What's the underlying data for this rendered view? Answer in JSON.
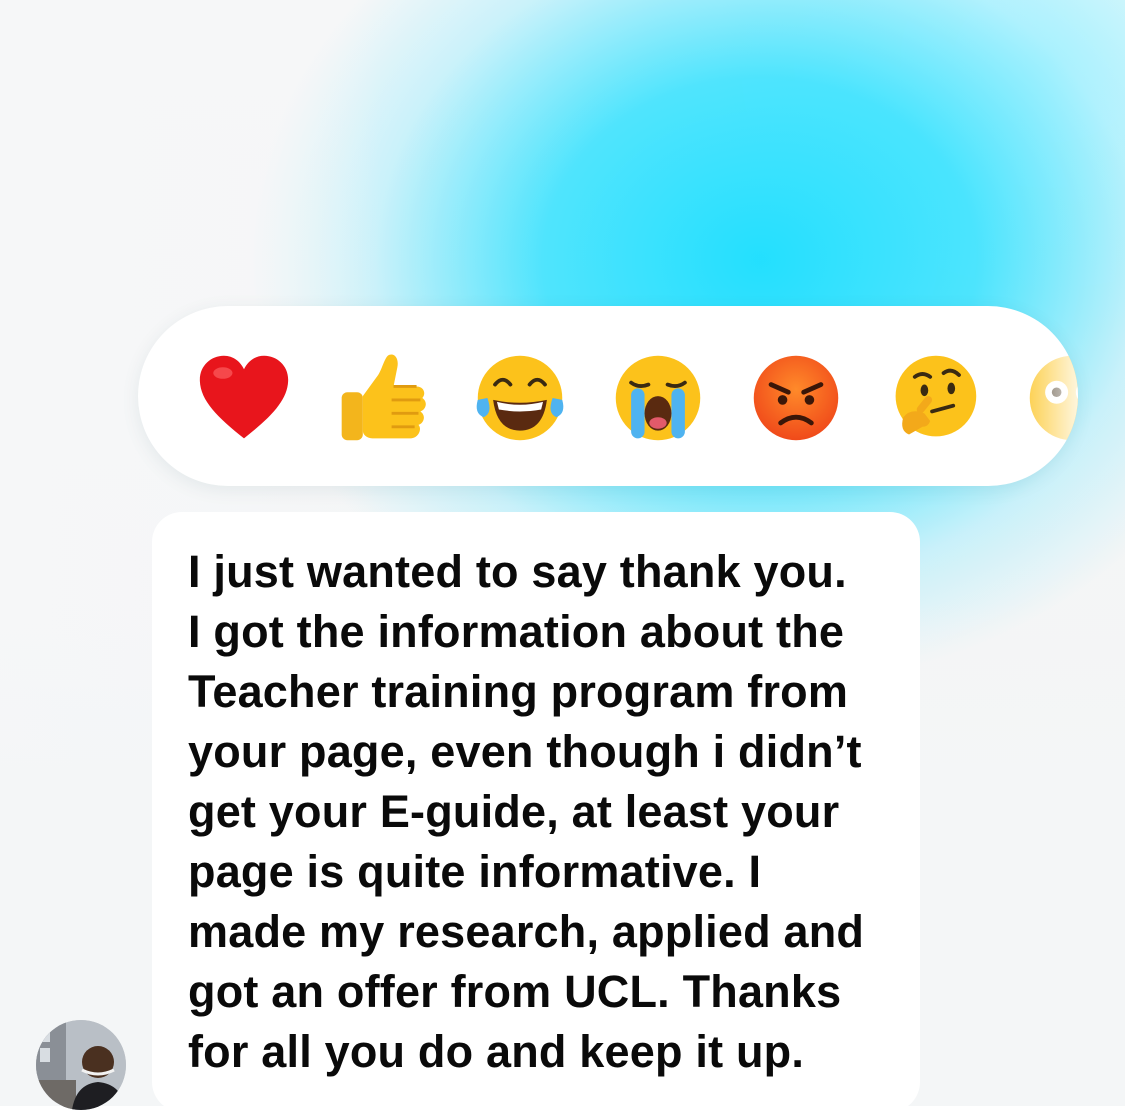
{
  "reactions": [
    {
      "name": "heart",
      "icon": "red-heart-icon"
    },
    {
      "name": "thumbs-up",
      "icon": "thumbs-up-icon"
    },
    {
      "name": "tears-of-joy",
      "icon": "laughing-face-icon"
    },
    {
      "name": "crying",
      "icon": "crying-face-icon"
    },
    {
      "name": "angry",
      "icon": "angry-face-icon"
    },
    {
      "name": "thinking",
      "icon": "thinking-face-icon"
    },
    {
      "name": "surprised",
      "icon": "surprised-face-icon"
    }
  ],
  "message": {
    "lines": [
      "I just wanted to say thank you.",
      "I got the information about the",
      "Teacher training program from",
      "your page, even though i didn’t",
      "get your E-guide, at least your",
      "page is quite informative. I",
      "made my research, applied and",
      "got an offer from UCL. Thanks",
      "for all you do and keep it up."
    ]
  },
  "avatar": {
    "icon": "user-avatar-icon"
  },
  "colors": {
    "accent_cyan": "#1ad8ff",
    "bubble": "#ffffff",
    "text": "#0a0a0a"
  }
}
